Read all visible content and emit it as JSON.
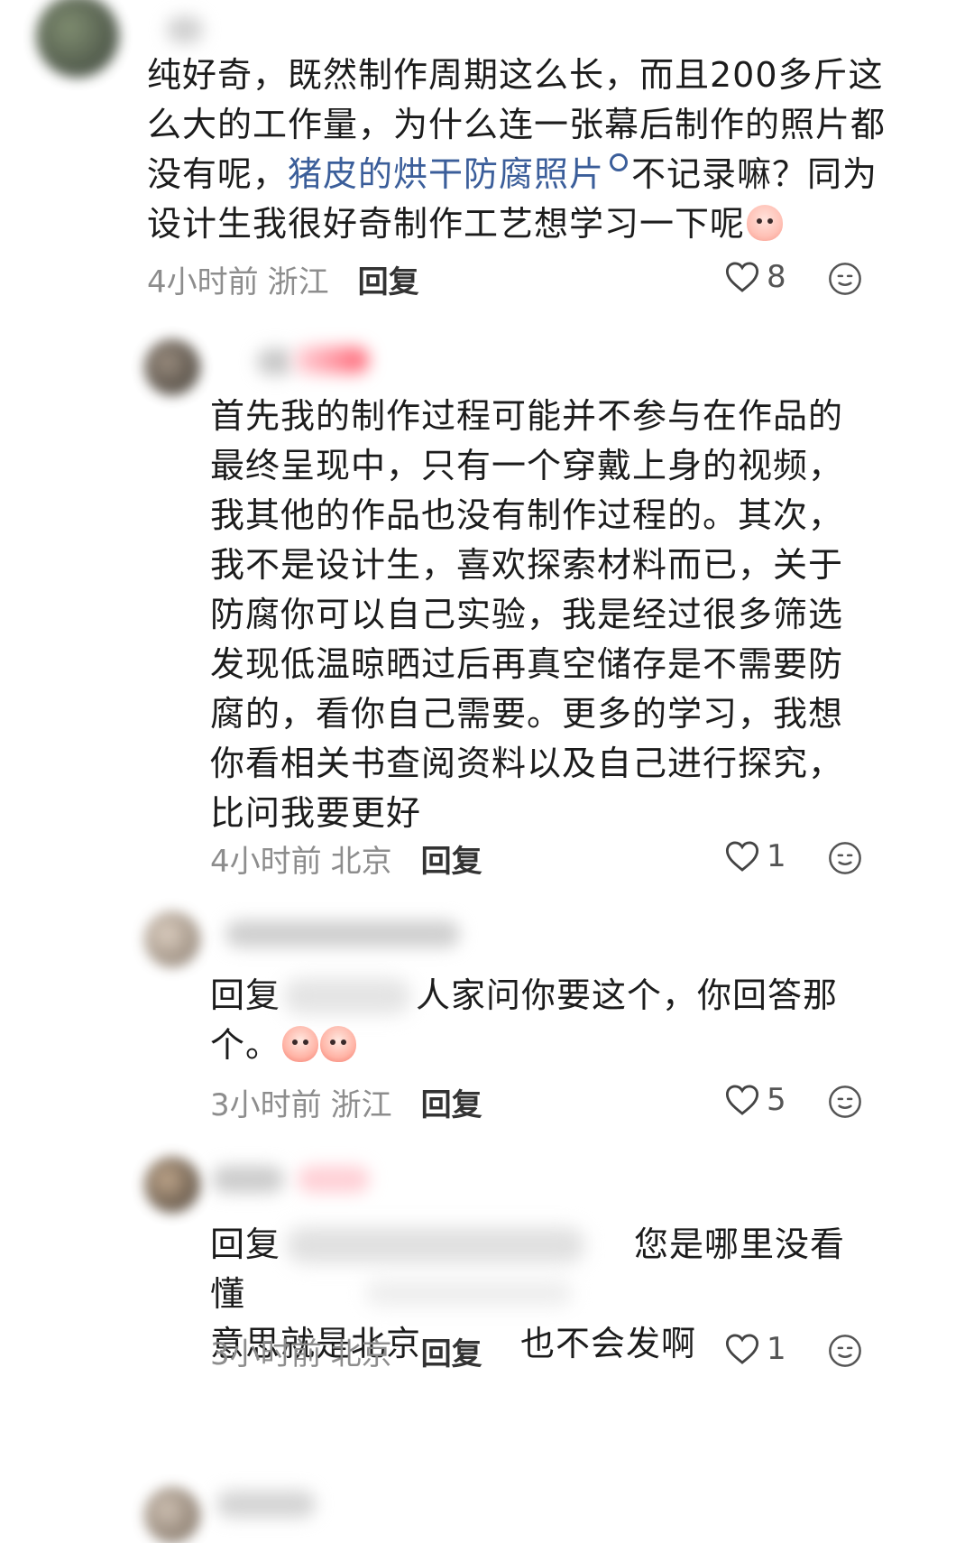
{
  "comments": [
    {
      "text_pre": "纯好奇，既然制作周期这么长，而且200多斤这么大的工作量，为什么连一张幕后制作的照片都没有呢，",
      "link": "猪皮的烘干防腐照片",
      "text_post": "不记录嘛？同为设计生我很好奇制作工艺想学习一下呢",
      "emoji": "blushing-face-emoji",
      "time": "4小时前",
      "location": "浙江",
      "reply": "回复",
      "likes": "8"
    },
    {
      "text": "首先我的制作过程可能并不参与在作品的最终呈现中，只有一个穿戴上身的视频，我其他的作品也没有制作过程的。其次，我不是设计生，喜欢探索材料而已，关于防腐你可以自己实验，我是经过很多筛选发现低温晾晒过后再真空储存是不需要防腐的，看你自己需要。更多的学习，我想你看相关书查阅资料以及自己进行探究，比问我要更好",
      "time": "4小时前",
      "location": "北京",
      "reply": "回复",
      "likes": "1"
    },
    {
      "prefix": "回复",
      "text": "人家问你要这个，你回答那个。",
      "emoji": "crying-face-emoji",
      "time": "3小时前",
      "location": "浙江",
      "reply": "回复",
      "likes": "5"
    },
    {
      "prefix": "回复",
      "text_a": "您是哪里没看懂",
      "text_b": "意思就是北京",
      "text_c": "也不会发啊",
      "time": "3小时前",
      "location": "北京",
      "reply": "回复",
      "likes": "1"
    }
  ],
  "colors": {
    "link": "#3b5e9a",
    "meta": "#8d8d8d",
    "text": "#1c1c1c"
  },
  "icons": [
    "heart-icon",
    "emoji-face-icon"
  ]
}
